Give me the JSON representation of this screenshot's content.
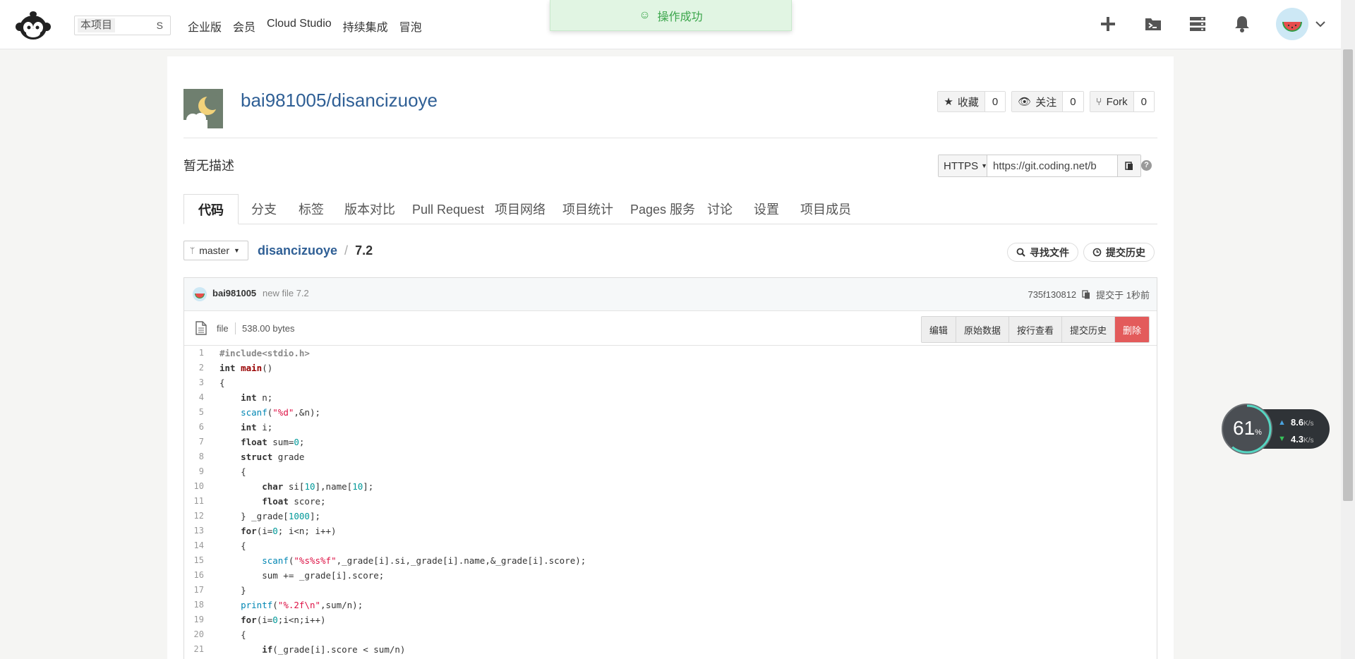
{
  "topbar": {
    "search_scope": "本项目",
    "search_shortcut": "S",
    "nav": [
      "企业版",
      "会员",
      "Cloud Studio",
      "持续集成",
      "冒泡"
    ],
    "toast": "操作成功"
  },
  "repo": {
    "full_name": "bai981005/disancizuoye",
    "counters": {
      "star_label": "收藏",
      "star_count": "0",
      "watch_label": "关注",
      "watch_count": "0",
      "fork_label": "Fork",
      "fork_count": "0"
    },
    "description": "暂无描述",
    "clone": {
      "protocol": "HTTPS",
      "url": "https://git.coding.net/b"
    },
    "help": "?"
  },
  "tabs": [
    "代码",
    "分支",
    "标签",
    "版本对比",
    "Pull Request",
    "项目网络",
    "项目统计",
    "Pages 服务",
    "讨论",
    "设置",
    "项目成员"
  ],
  "breadcrumb": {
    "branch": "master",
    "repo": "disancizuoye",
    "sep": "/",
    "file": "7.2"
  },
  "actions": {
    "find_file": "寻找文件",
    "history": "提交历史"
  },
  "commit": {
    "user": "bai981005",
    "message": "new file 7.2",
    "hash": "735f130812",
    "time": "提交于 1秒前"
  },
  "file": {
    "type": "file",
    "size": "538.00 bytes",
    "buttons": [
      "编辑",
      "原始数据",
      "按行查看",
      "提交历史",
      "删除"
    ]
  },
  "speed_widget": {
    "percent": "61",
    "percent_unit": "%",
    "up": "8.6",
    "down": "4.3",
    "unit": "K/s"
  },
  "colors": {
    "link": "#2f5f95",
    "toast_bg": "#e1f5e3",
    "toast_text": "#3aa54a",
    "danger": "#e35b5b"
  }
}
